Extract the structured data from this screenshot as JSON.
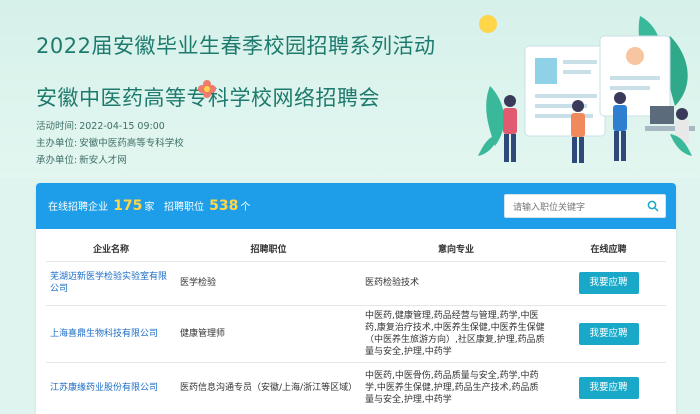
{
  "header": {
    "title": "2022届安徽毕业生春季校园招聘系列活动",
    "subtitle": "安徽中医药高等专科学校网络招聘会",
    "meta": [
      {
        "label": "活动时间:",
        "value": "2022-04-15 09:00"
      },
      {
        "label": "主办单位:",
        "value": "安徽中医药高等专科学校"
      },
      {
        "label": "承办单位:",
        "value": "新安人才网"
      }
    ]
  },
  "stats": {
    "companies_label": "在线招聘企业",
    "companies_count": "175",
    "companies_unit": "家",
    "positions_label": "招聘职位",
    "positions_count": "538",
    "positions_unit": "个"
  },
  "search": {
    "placeholder": "请输入职位关键字",
    "icon": "search-icon"
  },
  "table": {
    "headers": [
      "企业名称",
      "招聘职位",
      "意向专业",
      "在线应聘"
    ],
    "rows": [
      {
        "company": "芜湖迈新医学检验实验室有限公司",
        "position": "医学检验",
        "majors": "医药检验技术",
        "action": "我要应聘"
      },
      {
        "company": "上海喜鼎生物科技有限公司",
        "position": "健康管理师",
        "majors": "中医药,健康管理,药品经营与管理,药学,中医药,康复治疗技术,中医养生保健,中医养生保健（中医养生旅游方向）,社区康复,护理,药品质量与安全,护理,中药学",
        "action": "我要应聘"
      },
      {
        "company": "江苏康缘药业股份有限公司",
        "position": "医药信息沟通专员（安徽/上海/浙江等区域）",
        "majors": "中医药,中医骨伤,药品质量与安全,药学,中药学,中医养生保健,护理,药品生产技术,药品质量与安全,护理,中药学",
        "action": "我要应聘"
      }
    ]
  },
  "colors": {
    "accent": "#1e9ee8",
    "button": "#1aa8c9",
    "title": "#1f7a6e",
    "highlight": "#ffd54a",
    "company_link": "#1c6dc4"
  }
}
